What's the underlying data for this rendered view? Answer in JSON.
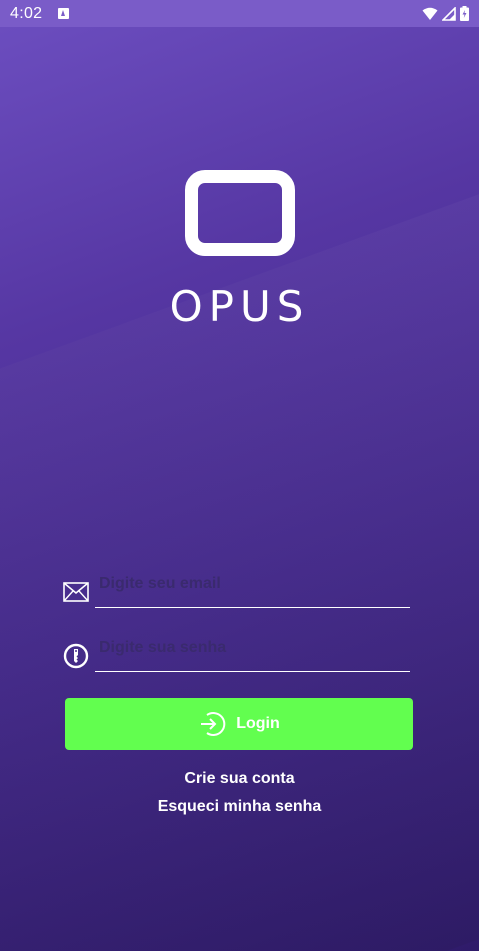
{
  "status_bar": {
    "time": "4:02",
    "icons": [
      "app-notification-icon",
      "wifi-icon",
      "signal-icon",
      "battery-icon"
    ]
  },
  "brand": {
    "name": "OPUS",
    "logo_icon": "rounded-square-logo"
  },
  "form": {
    "email": {
      "placeholder": "Digite seu email",
      "value": "",
      "icon": "envelope-icon"
    },
    "password": {
      "placeholder": "Digite sua senha",
      "value": "",
      "icon": "key-icon"
    },
    "login_button": {
      "label": "Login",
      "icon": "login-arrow-icon"
    }
  },
  "links": {
    "create_account": "Crie sua conta",
    "forgot_password": "Esqueci minha senha"
  },
  "colors": {
    "accent": "#62fe4f",
    "background_top": "#6d4fc1",
    "background_bottom": "#2f1b6a",
    "status_bar": "#7a5cc8",
    "placeholder": "#3a2a6e"
  }
}
